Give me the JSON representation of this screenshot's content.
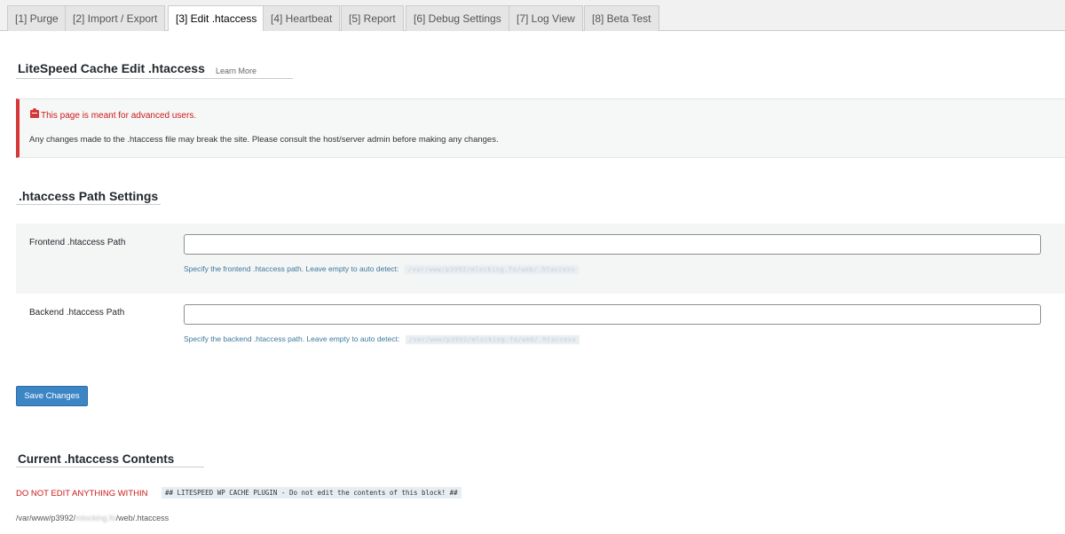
{
  "tabs": [
    {
      "label": "[1] Purge",
      "active": false
    },
    {
      "label": "[2] Import / Export",
      "active": false
    },
    {
      "label": "[3] Edit .htaccess",
      "active": true
    },
    {
      "label": "[4] Heartbeat",
      "active": false
    },
    {
      "label": "[5] Report",
      "active": false
    },
    {
      "label": "[6] Debug Settings",
      "active": false
    },
    {
      "label": "[7] Log View",
      "active": false
    },
    {
      "label": "[8] Beta Test",
      "active": false
    }
  ],
  "page": {
    "title": "LiteSpeed Cache Edit .htaccess",
    "learn_more": "Learn More"
  },
  "warning": {
    "heading": "This page is meant for advanced users.",
    "body": "Any changes made to the .htaccess file may break the site. Please consult the host/server admin before making any changes.",
    "color": "#d63638"
  },
  "path_settings": {
    "heading": ".htaccess Path Settings",
    "frontend": {
      "label": "Frontend .htaccess Path",
      "value": "",
      "description": "Specify the frontend .htaccess path. Leave empty to auto detect:",
      "detected": "/var/www/p3992/mlocking.fo/web/.htaccess"
    },
    "backend": {
      "label": "Backend .htaccess Path",
      "value": "",
      "description": "Specify the backend .htaccess path. Leave empty to auto detect:",
      "detected": "/var/www/p3992/mlocking.fo/web/.htaccess"
    }
  },
  "save_button": "Save Changes",
  "current": {
    "heading": "Current .htaccess Contents",
    "do_not_edit": "DO NOT EDIT ANYTHING WITHIN",
    "marker": "## LITESPEED WP CACHE PLUGIN - Do not edit the contents of this block! ##",
    "path_prefix": "/var/www/p3992/",
    "path_blurred": "mlocking.fo",
    "path_suffix": "/web/.htaccess"
  },
  "colors": {
    "accent": "#3d86c6",
    "danger": "#cc1a1a"
  }
}
